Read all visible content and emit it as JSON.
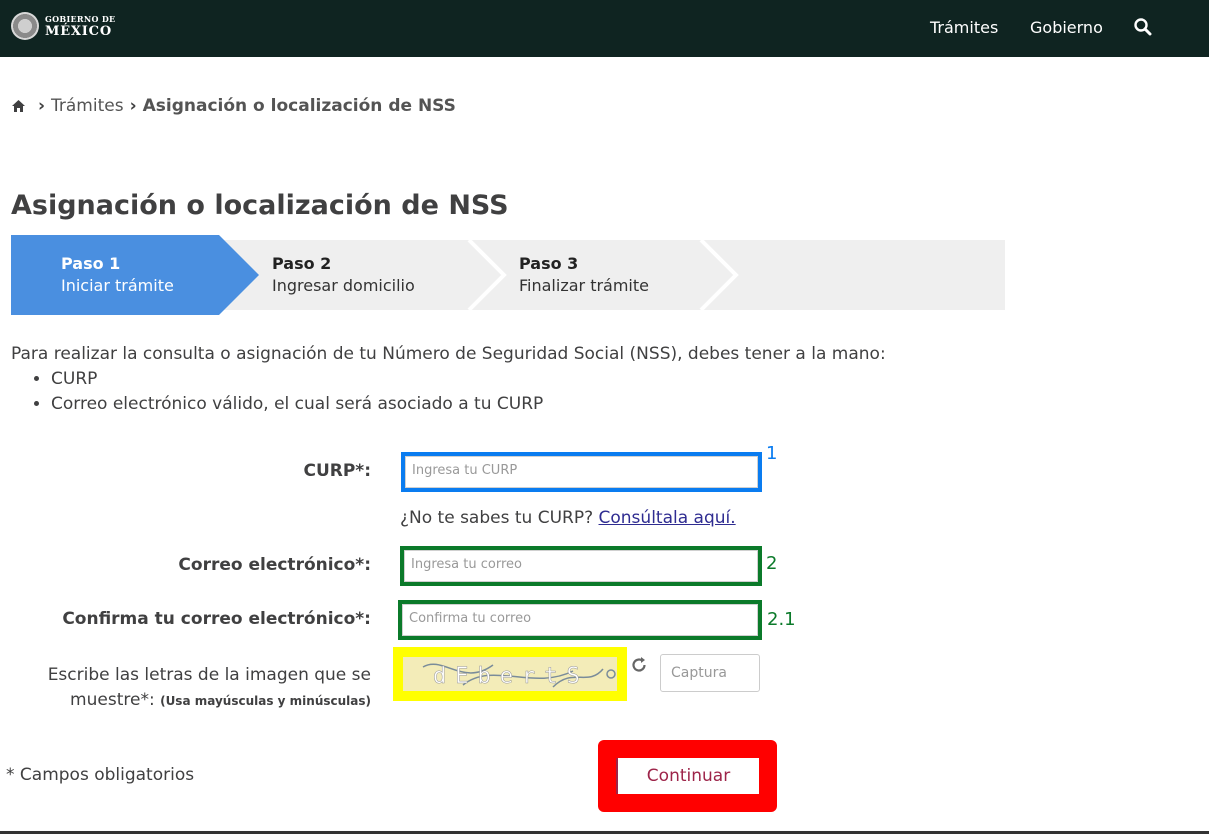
{
  "header": {
    "logo_line1": "GOBIERNO DE",
    "logo_line2": "MÉXICO",
    "nav": [
      "Trámites",
      "Gobierno"
    ]
  },
  "breadcrumb": {
    "parent": "Trámites",
    "current": "Asignación o localización de NSS"
  },
  "page_title": "Asignación o localización de NSS",
  "steps": [
    {
      "title": "Paso 1",
      "subtitle": "Iniciar trámite",
      "active": true
    },
    {
      "title": "Paso 2",
      "subtitle": "Ingresar domicilio",
      "active": false
    },
    {
      "title": "Paso 3",
      "subtitle": "Finalizar trámite",
      "active": false
    }
  ],
  "intro": {
    "text": "Para realizar la consulta o asignación de tu Número de Seguridad Social (NSS), debes tener a la mano:",
    "items": [
      "CURP",
      "Correo electrónico válido, el cual será asociado a tu CURP"
    ]
  },
  "form": {
    "curp": {
      "label": "CURP*:",
      "placeholder": "Ingresa tu CURP",
      "tag": "1"
    },
    "hint_text": "¿No te sabes tu CURP?",
    "hint_link": "Consúltala aquí.",
    "email": {
      "label": "Correo electrónico*:",
      "placeholder": "Ingresa tu correo",
      "tag": "2"
    },
    "email_confirm": {
      "label": "Confirma tu correo electrónico*:",
      "placeholder": "Confirma tu correo",
      "tag": "2.1"
    },
    "captcha": {
      "label_line1": "Escribe las letras de la imagen que se",
      "label_line2": "muestre*:",
      "label_note": "(Usa mayúsculas y minúsculas)",
      "image_text": "dEbertS",
      "placeholder": "Captura"
    },
    "required_note": "* Campos obligatorios",
    "continue_label": "Continuar"
  },
  "colors": {
    "header_bg": "#0f2421",
    "step_active": "#4a8fe0",
    "curp_highlight": "#0a7cf0",
    "email_highlight": "#0b7a2a",
    "captcha_highlight": "#ffff00",
    "button_highlight": "#ff0000",
    "button_text": "#9d2449"
  }
}
